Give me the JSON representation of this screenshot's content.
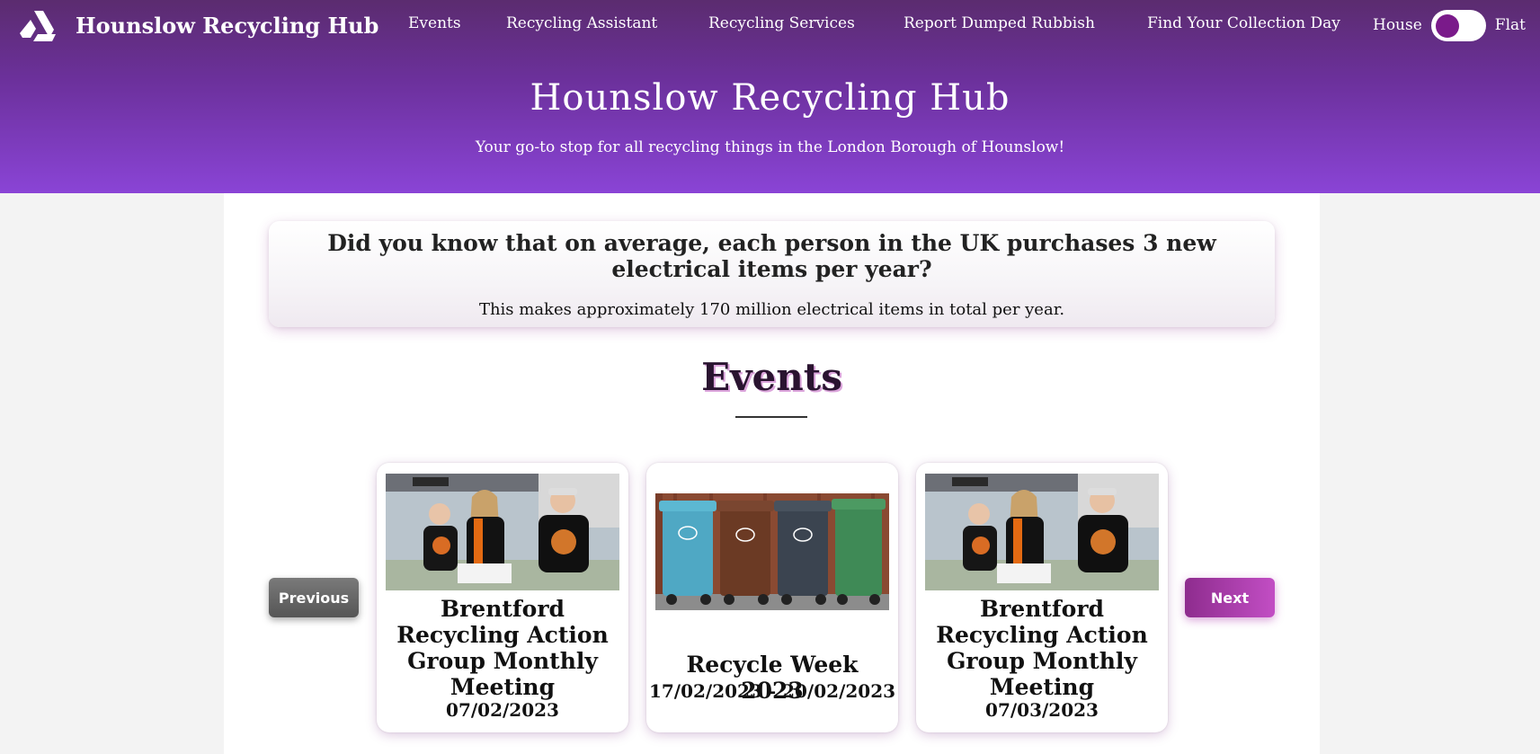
{
  "navbar": {
    "brand_title": "Hounslow Recycling Hub",
    "brand_icon": "recycle-triangle-icon",
    "links": [
      {
        "label": "Events"
      },
      {
        "label": "Recycling Assistant"
      },
      {
        "label": "Recycling Services"
      },
      {
        "label": "Report Dumped Rubbish"
      },
      {
        "label": "Find Your Collection Day"
      }
    ],
    "toggle": {
      "left_label": "House",
      "right_label": "Flat",
      "selected": "House"
    }
  },
  "hero": {
    "title": "Hounslow Recycling Hub",
    "subtitle": "Your go-to stop for all recycling things in the London Borough of Hounslow!"
  },
  "fact": {
    "title": "Did you know that on average, each person in the UK purchases 3 new electrical items per year?",
    "text": "This makes approximately 170 million electrical items in total per year."
  },
  "events": {
    "heading": "Events",
    "prev_label": "Previous",
    "next_label": "Next",
    "cards": [
      {
        "title": "Brentford Recycling Action Group Monthly Meeting",
        "date": "07/02/2023",
        "image": "volunteers-photo"
      },
      {
        "title": "Recycle Week 2023",
        "date": "17/02/2023 - 20/02/2023",
        "image": "wheelie-bins-photo"
      },
      {
        "title": "Brentford Recycling Action Group Monthly Meeting",
        "date": "07/03/2023",
        "image": "volunteers-photo"
      }
    ]
  },
  "colors": {
    "header_top": "#5b2c6f",
    "header_bottom": "#8a44d6",
    "accent": "#7a1a8a",
    "next_button": "#a63aa8",
    "prev_button": "#666666"
  }
}
